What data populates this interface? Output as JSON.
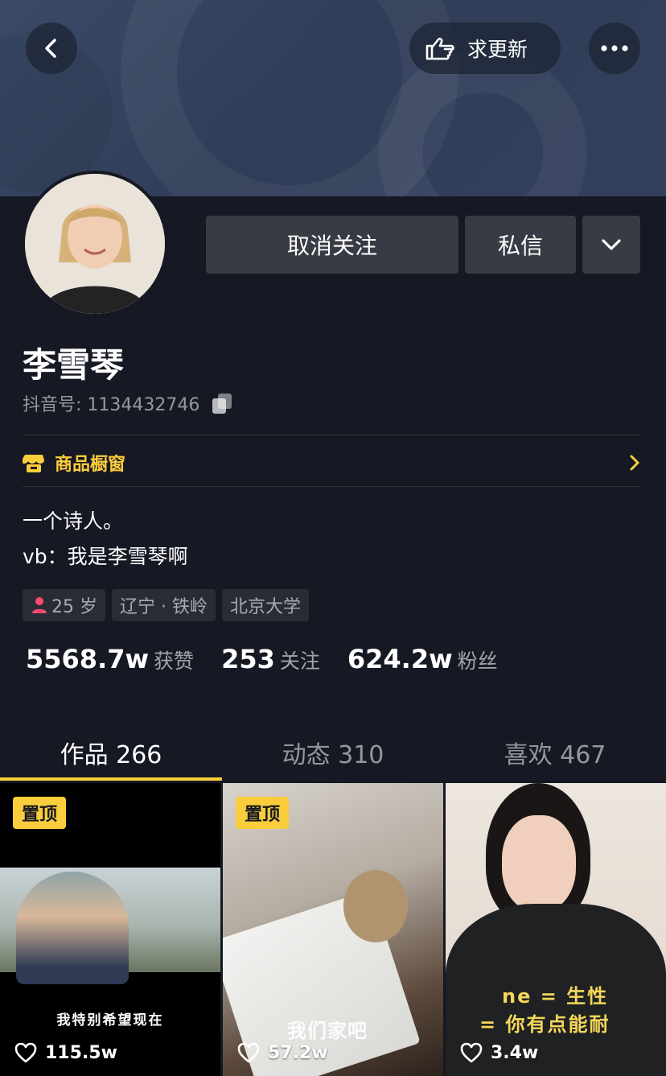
{
  "header": {
    "back_icon": "chevron-left-icon",
    "update_label": "求更新",
    "update_icon": "pointing-hand-icon",
    "more_icon": "ellipsis-icon"
  },
  "actions": {
    "unfollow_label": "取消关注",
    "message_label": "私信",
    "dropdown_icon": "chevron-down-icon"
  },
  "profile": {
    "name": "李雪琴",
    "id_label": "抖音号: 1134432746",
    "copy_icon": "copy-icon"
  },
  "shop": {
    "label": "商品橱窗",
    "icon": "shop-icon",
    "color": "#facd3c"
  },
  "bio": {
    "line1": "一个诗人。",
    "line2": "vb：我是李雪琴啊"
  },
  "tags": {
    "age": "25 岁",
    "gender_icon": "female-icon",
    "location": "辽宁 · 铁岭",
    "school": "北京大学"
  },
  "stats": {
    "likes_num": "5568.7w",
    "likes_label": "获赞",
    "following_num": "253",
    "following_label": "关注",
    "fans_num": "624.2w",
    "fans_label": "粉丝"
  },
  "tabs": [
    {
      "label": "作品 266"
    },
    {
      "label": "动态 310"
    },
    {
      "label": "喜欢 467"
    }
  ],
  "videos": [
    {
      "pinned_label": "置顶",
      "caption": "我特别希望现在",
      "likes": "115.5w"
    },
    {
      "pinned_label": "置顶",
      "caption": "我们家吧",
      "likes": "57.2w"
    },
    {
      "caption_line1": "ne = 生性",
      "caption_line2": "= 你有点能耐",
      "likes": "3.4w"
    }
  ],
  "colors": {
    "background": "#161823",
    "accent": "#facd3c",
    "button": "#393b44"
  }
}
